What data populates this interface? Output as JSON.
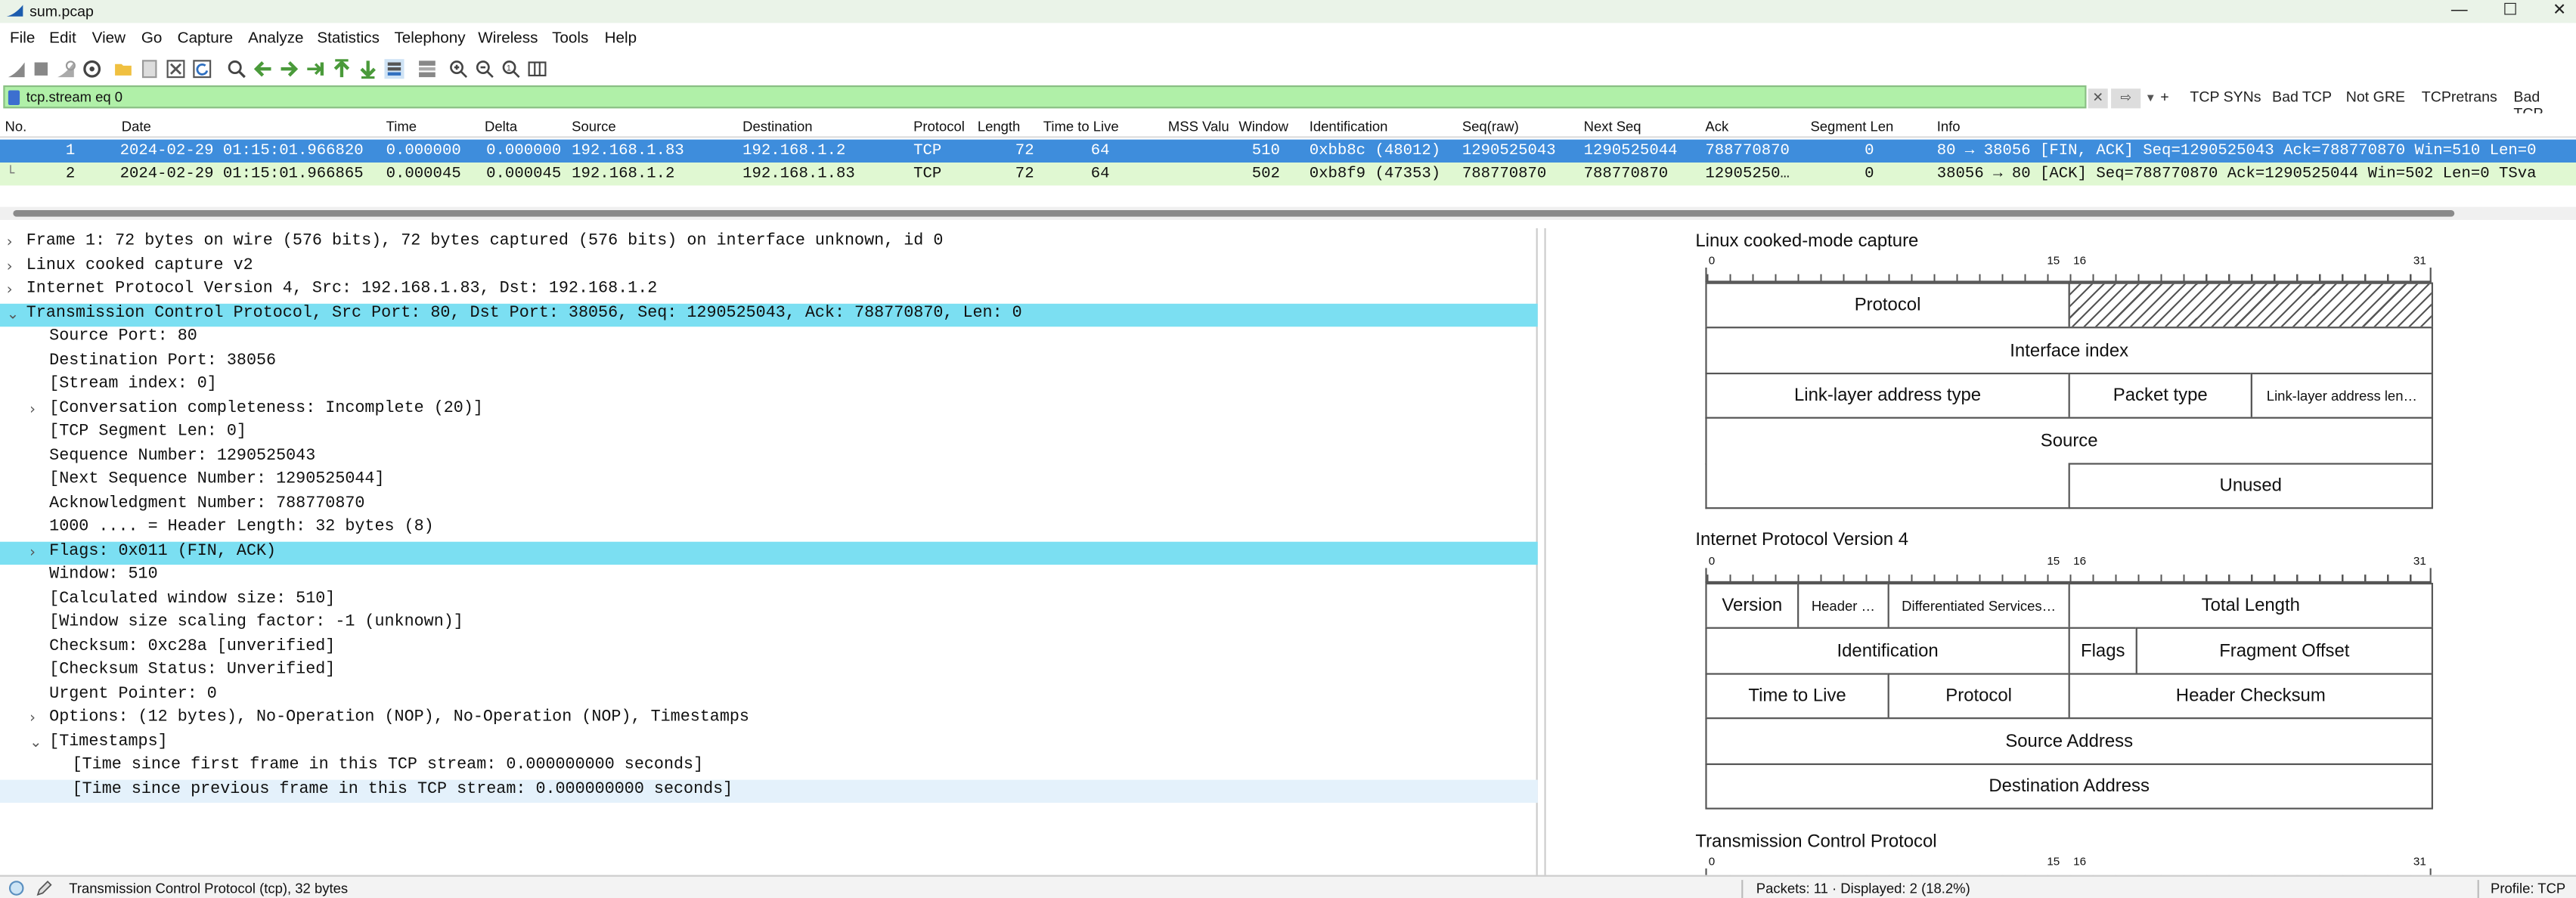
{
  "window": {
    "title": "sum.pcap"
  },
  "menu": [
    "File",
    "Edit",
    "View",
    "Go",
    "Capture",
    "Analyze",
    "Statistics",
    "Telephony",
    "Wireless",
    "Tools",
    "Help"
  ],
  "filter": {
    "value": "tcp.stream eq 0",
    "buttons": [
      "TCP SYNs",
      "Bad TCP",
      "Not GRE",
      "TCPretrans",
      "Bad TCP"
    ],
    "plus": "+"
  },
  "packet_list": {
    "columns": [
      "No.",
      "Date",
      "Time",
      "Delta",
      "Source",
      "Destination",
      "Protocol",
      "Length",
      "Time to Live",
      "MSS Valu",
      "Window",
      "Identification",
      "Seq(raw)",
      "Next Seq",
      "Ack",
      "Segment Len",
      "Info"
    ],
    "rows": [
      {
        "no": "1",
        "date": "2024-02-29 01:15:01.966820",
        "time": "0.000000",
        "delta": "0.000000",
        "src": "192.168.1.83",
        "dst": "192.168.1.2",
        "proto": "TCP",
        "len": "72",
        "ttl": "64",
        "mss": "",
        "win": "510",
        "id": "0xbb8c (48012)",
        "seq": "1290525043",
        "nseq": "1290525044",
        "ack": "788770870",
        "seglen": "0",
        "info": "80 → 38056 [FIN, ACK] Seq=1290525043 Ack=788770870 Win=510 Len=0"
      },
      {
        "no": "2",
        "date": "2024-02-29 01:15:01.966865",
        "time": "0.000045",
        "delta": "0.000045",
        "src": "192.168.1.2",
        "dst": "192.168.1.83",
        "proto": "TCP",
        "len": "72",
        "ttl": "64",
        "mss": "",
        "win": "502",
        "id": "0xb8f9 (47353)",
        "seq": "788770870",
        "nseq": "788770870",
        "ack": "12905250…",
        "seglen": "0",
        "info": "38056 → 80 [ACK] Seq=788770870 Ack=1290525044 Win=502 Len=0 TSva"
      }
    ]
  },
  "details": [
    {
      "arrow": "›",
      "text": "Frame 1: 72 bytes on wire (576 bits), 72 bytes captured (576 bits) on interface unknown, id 0"
    },
    {
      "arrow": "›",
      "text": "Linux cooked capture v2"
    },
    {
      "arrow": "›",
      "text": "Internet Protocol Version 4, Src: 192.168.1.83, Dst: 192.168.1.2"
    },
    {
      "arrow": "⌄",
      "text": "Transmission Control Protocol, Src Port: 80, Dst Port: 38056, Seq: 1290525043, Ack: 788770870, Len: 0"
    },
    {
      "arrow": "",
      "text": "Source Port: 80"
    },
    {
      "arrow": "",
      "text": "Destination Port: 38056"
    },
    {
      "arrow": "",
      "text": "[Stream index: 0]"
    },
    {
      "arrow": "›",
      "text": "[Conversation completeness: Incomplete (20)]"
    },
    {
      "arrow": "",
      "text": "[TCP Segment Len: 0]"
    },
    {
      "arrow": "",
      "text": "Sequence Number: 1290525043"
    },
    {
      "arrow": "",
      "text": "[Next Sequence Number: 1290525044]"
    },
    {
      "arrow": "",
      "text": "Acknowledgment Number: 788770870"
    },
    {
      "arrow": "",
      "text": "1000 .... = Header Length: 32 bytes (8)"
    },
    {
      "arrow": "›",
      "text": "Flags: 0x011 (FIN, ACK)"
    },
    {
      "arrow": "",
      "text": "Window: 510"
    },
    {
      "arrow": "",
      "text": "[Calculated window size: 510]"
    },
    {
      "arrow": "",
      "text": "[Window size scaling factor: -1 (unknown)]"
    },
    {
      "arrow": "",
      "text": "Checksum: 0xc28a [unverified]"
    },
    {
      "arrow": "",
      "text": "[Checksum Status: Unverified]"
    },
    {
      "arrow": "",
      "text": "Urgent Pointer: 0"
    },
    {
      "arrow": "›",
      "text": "Options: (12 bytes), No-Operation (NOP), No-Operation (NOP), Timestamps"
    },
    {
      "arrow": "⌄",
      "text": "[Timestamps]"
    },
    {
      "arrow": "",
      "text": "[Time since first frame in this TCP stream: 0.000000000 seconds]"
    },
    {
      "arrow": "",
      "text": "[Time since previous frame in this TCP stream: 0.000000000 seconds]"
    }
  ],
  "diagram": {
    "sections": [
      "Linux cooked-mode capture",
      "Internet Protocol Version 4",
      "Transmission Control Protocol"
    ],
    "ruler": [
      "0",
      "15",
      "16",
      "31"
    ],
    "linux": {
      "protocol": "Protocol",
      "interface_index": "Interface index",
      "ll_addr_type": "Link-layer address type",
      "packet_type": "Packet type",
      "ll_addr_len": "Link-layer address len…",
      "source": "Source",
      "unused": "Unused"
    },
    "ipv4": {
      "version": "Version",
      "header": "Header …",
      "dsf": "Differentiated Services…",
      "total_length": "Total Length",
      "identification": "Identification",
      "flags": "Flags",
      "fragment_offset": "Fragment Offset",
      "ttl": "Time to Live",
      "protocol": "Protocol",
      "header_checksum": "Header Checksum",
      "source_address": "Source Address",
      "destination_address": "Destination Address"
    }
  },
  "status": {
    "left": "Transmission Control Protocol (tcp), 32 bytes",
    "packets": "Packets: 11 · Displayed: 2 (18.2%)",
    "profile": "Profile: TCP"
  },
  "colors": {
    "selected_row": "#3e8ddc",
    "row2": "#e0f8d2",
    "filter_bg": "#b0f0a8",
    "detail_selected": "#7bdff2"
  }
}
